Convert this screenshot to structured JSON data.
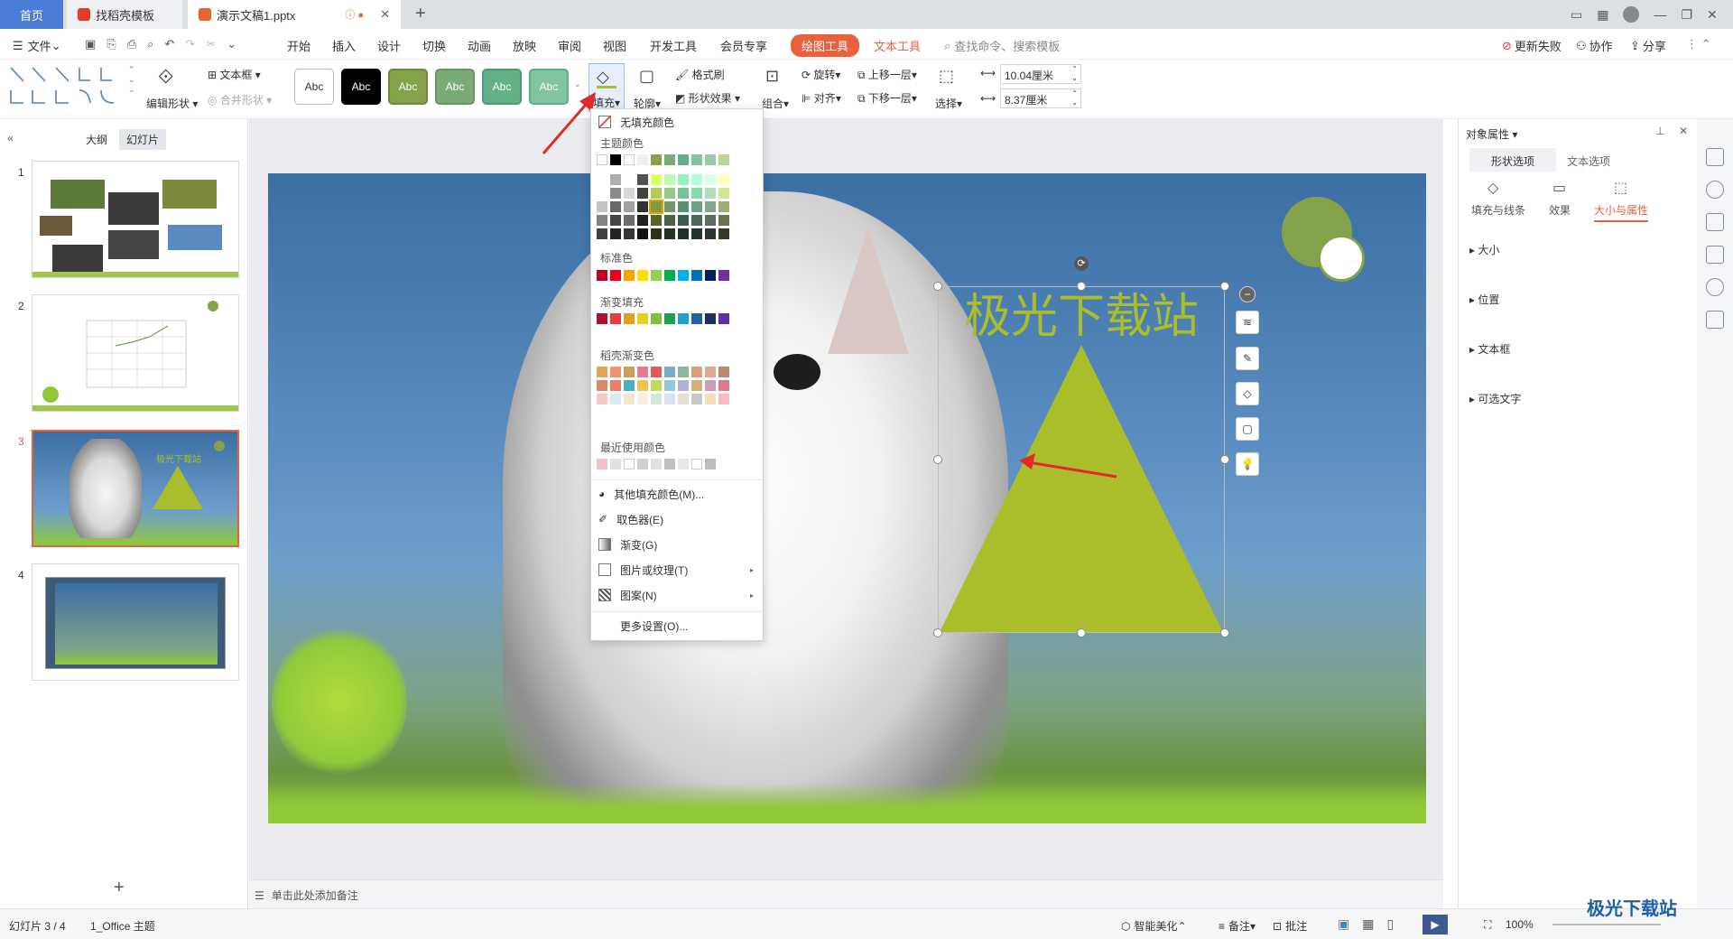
{
  "tabs": {
    "home": "首页",
    "templates": "找稻壳模板",
    "doc": "演示文稿1.pptx"
  },
  "menubar": {
    "file": "文件",
    "items": [
      "开始",
      "插入",
      "设计",
      "切换",
      "动画",
      "放映",
      "审阅",
      "视图",
      "开发工具",
      "会员专享"
    ],
    "drawing_tools": "绘图工具",
    "text_tools": "文本工具",
    "search_placeholder": "查找命令、搜索模板",
    "update_failed": "更新失败",
    "collab": "协作",
    "share": "分享"
  },
  "toolbar": {
    "edit_shape": "编辑形状",
    "textbox": "文本框",
    "merge_shape": "合并形状",
    "style_label": "Abc",
    "fill": "填充",
    "outline": "轮廓",
    "format_painter": "格式刷",
    "shape_effect": "形状效果",
    "group": "组合",
    "rotate": "旋转",
    "align": "对齐",
    "bring_forward": "上移一层",
    "send_backward": "下移一层",
    "select": "选择",
    "width": "10.04厘米",
    "height": "8.37厘米"
  },
  "leftpane": {
    "outline_tab": "大纲",
    "slides_tab": "幻灯片",
    "slide_nums": [
      "1",
      "2",
      "3",
      "4"
    ],
    "thumb3_text": "极光下载站"
  },
  "slide": {
    "title": "极光下载站"
  },
  "notes": {
    "placeholder": "单击此处添加备注"
  },
  "fillmenu": {
    "no_fill": "无填充颜色",
    "theme_colors": "主题颜色",
    "standard": "标准色",
    "gradient": "渐变填充",
    "docer_gradient": "稻壳渐变色",
    "recent": "最近使用颜色",
    "more_colors": "其他填充颜色(M)...",
    "eyedropper": "取色器(E)",
    "gradient_item": "渐变(G)",
    "picture": "图片或纹理(T)",
    "pattern": "图案(N)",
    "more_settings": "更多设置(O)..."
  },
  "rightpane": {
    "title": "对象属性",
    "shape_tab": "形状选项",
    "text_tab": "文本选项",
    "sub_fill": "填充与线条",
    "sub_effect": "效果",
    "sub_size": "大小与属性",
    "sections": [
      "大小",
      "位置",
      "文本框",
      "可选文字"
    ]
  },
  "status": {
    "slide": "幻灯片 3 / 4",
    "theme": "1_Office 主题",
    "beautify": "智能美化",
    "notes": "备注",
    "comments": "批注",
    "zoom": "100%"
  },
  "watermark": "极光下载站",
  "colors": {
    "accent": "#4b7cd6",
    "drawing_tools": "#e8603c",
    "shape": "#a9be2a",
    "circle": "#84a24a"
  }
}
